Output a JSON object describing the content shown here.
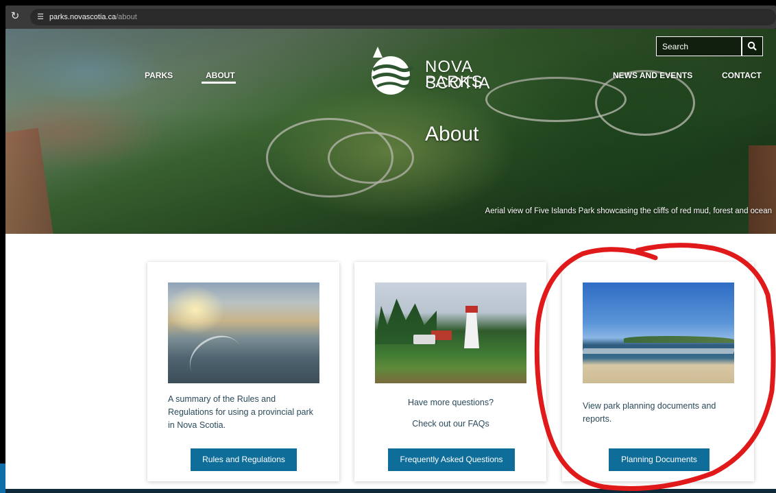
{
  "browser": {
    "reload_icon": "reload-icon",
    "site_info_icon": "site-info-icon",
    "url_host": "parks.novascotia.ca",
    "url_path": "/about"
  },
  "header": {
    "nav_left": [
      "PARKS",
      "ABOUT"
    ],
    "nav_right": [
      "NEWS AND EVENTS",
      "CONTACT"
    ],
    "active_nav": "ABOUT",
    "logo_line1": "NOVA SCOTIA",
    "logo_line2": "PARKS",
    "search_placeholder": "Search",
    "search_icon": "search-icon"
  },
  "hero": {
    "title": "About",
    "caption": "Aerial view of Five Islands Park showcasing the cliffs of red mud, forest and ocean"
  },
  "cards": [
    {
      "paragraphs": [
        "A summary of the Rules and Regulations for using a provincial park in Nova Scotia."
      ],
      "button": "Rules and Regulations"
    },
    {
      "paragraphs": [
        "Have more questions?",
        "Check out our FAQs"
      ],
      "button": "Frequently Asked Questions"
    },
    {
      "paragraphs": [
        "View park planning documents and reports."
      ],
      "button": "Planning Documents"
    }
  ],
  "colors": {
    "button_bg": "#0f6d9a",
    "card_text": "#2a4a5a",
    "annotation_red": "#e0191b"
  }
}
